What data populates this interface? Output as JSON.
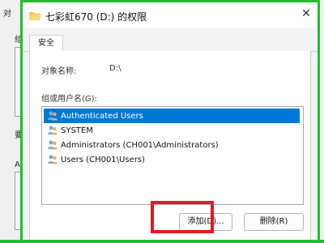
{
  "background_window": {
    "title_fragment": "对",
    "fragments": [
      "组",
      "要",
      "Au"
    ]
  },
  "dialog": {
    "title": "七彩虹670 (D:) 的权限",
    "close_icon": "close-icon",
    "tabs": [
      {
        "label": "安全"
      }
    ],
    "object_name_label": "对象名称:",
    "object_name_value": "D:\\",
    "group_users_label": "组或用户名(G):",
    "users": [
      {
        "name": "Authenticated Users",
        "icon": "users-icon",
        "selected": true
      },
      {
        "name": "SYSTEM",
        "icon": "users-icon",
        "selected": false
      },
      {
        "name": "Administrators (CH001\\Administrators)",
        "icon": "users-icon",
        "selected": false
      },
      {
        "name": "Users (CH001\\Users)",
        "icon": "users-icon",
        "selected": false
      }
    ],
    "buttons": {
      "add": "添加(D)...",
      "remove": "删除(R)"
    }
  },
  "colors": {
    "accent_border": "#1ec02e",
    "highlight": "#e01b24",
    "selection": "#0078d7"
  }
}
